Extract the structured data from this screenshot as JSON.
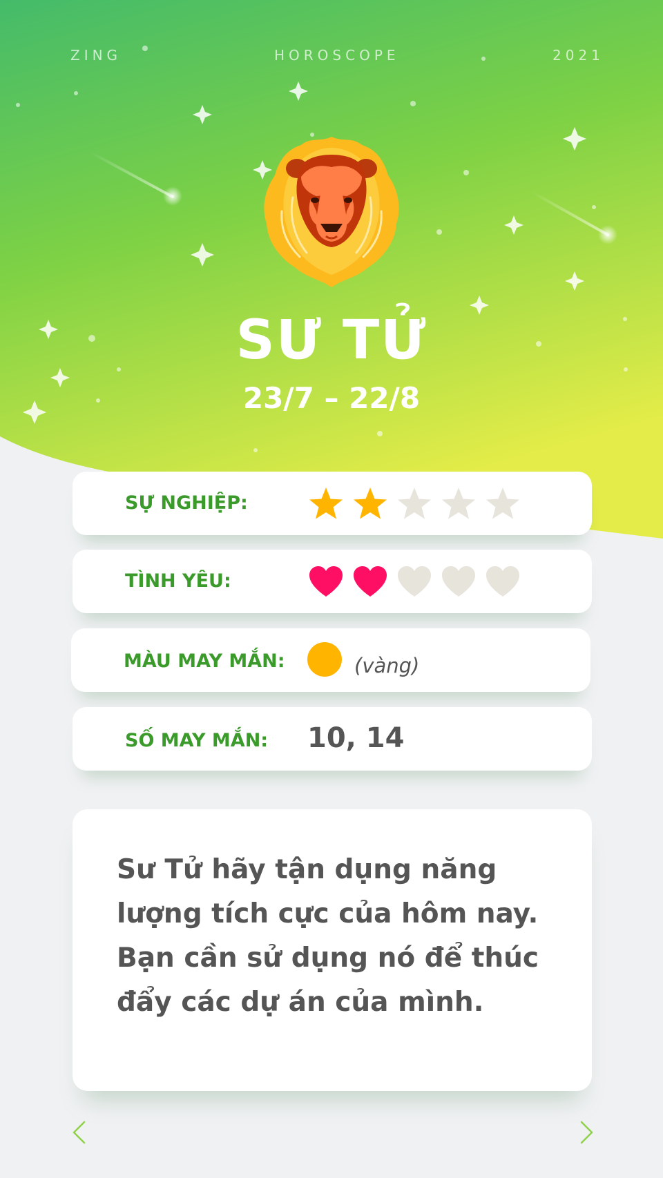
{
  "header": {
    "left": "ZING",
    "center": "HOROSCOPE",
    "right": "2021"
  },
  "sign": {
    "name": "SƯ TỬ",
    "dates": "23/7 – 22/8",
    "icon": "lion-icon"
  },
  "ratings": {
    "career": {
      "label": "SỰ NGHIỆP:",
      "value": 2,
      "max": 5,
      "icon": "star-icon",
      "color": "#ffb400"
    },
    "love": {
      "label": "TÌNH YÊU:",
      "value": 2,
      "max": 5,
      "icon": "heart-icon",
      "color": "#ff0f63"
    }
  },
  "lucky_color": {
    "label": "MÀU MAY MẮN:",
    "value": "(vàng)",
    "hex": "#ffb400"
  },
  "lucky_number": {
    "label": "SỐ MAY MẮN:",
    "value": "10, 14"
  },
  "description": "Sư Tử hãy tận dụng năng lượng tích cực của hôm nay. Bạn cần sử dụng nó để thúc đẩy các dự án của mình.",
  "colors": {
    "accent_green": "#3a9a2a",
    "inactive": "#e7e4dc"
  },
  "nav": {
    "prev_icon": "chevron-left-icon",
    "next_icon": "chevron-right-icon"
  }
}
